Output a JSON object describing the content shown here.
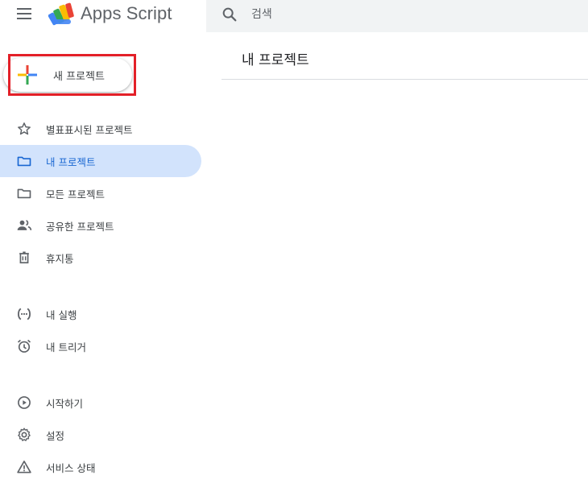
{
  "header": {
    "app_title": "Apps Script",
    "menu_icon": "hamburger-menu-icon",
    "logo_icon": "apps-script-logo",
    "search": {
      "placeholder": "검색",
      "value": ""
    }
  },
  "main": {
    "title": "내 프로젝트"
  },
  "new_project": {
    "label": "새 프로젝트",
    "highlight_color": "#e32028"
  },
  "sidebar": {
    "sections": [
      {
        "items": [
          {
            "label": "별표표시된 프로젝트",
            "icon": "star-icon",
            "active": false
          },
          {
            "label": "내 프로젝트",
            "icon": "folder-icon",
            "active": true
          },
          {
            "label": "모든 프로젝트",
            "icon": "folder-icon",
            "active": false
          },
          {
            "label": "공유한 프로젝트",
            "icon": "people-icon",
            "active": false
          },
          {
            "label": "휴지통",
            "icon": "trash-icon",
            "active": false
          }
        ]
      },
      {
        "items": [
          {
            "label": "내 실행",
            "icon": "executions-icon",
            "active": false
          },
          {
            "label": "내 트리거",
            "icon": "alarm-clock-icon",
            "active": false
          }
        ]
      },
      {
        "items": [
          {
            "label": "시작하기",
            "icon": "play-circle-icon",
            "active": false
          },
          {
            "label": "설정",
            "icon": "gear-icon",
            "active": false
          },
          {
            "label": "서비스 상태",
            "icon": "warning-icon",
            "active": false
          }
        ]
      }
    ]
  },
  "colors": {
    "active_bg": "#d2e3fc",
    "active_text": "#1967d2",
    "search_bg": "#f1f3f4"
  }
}
